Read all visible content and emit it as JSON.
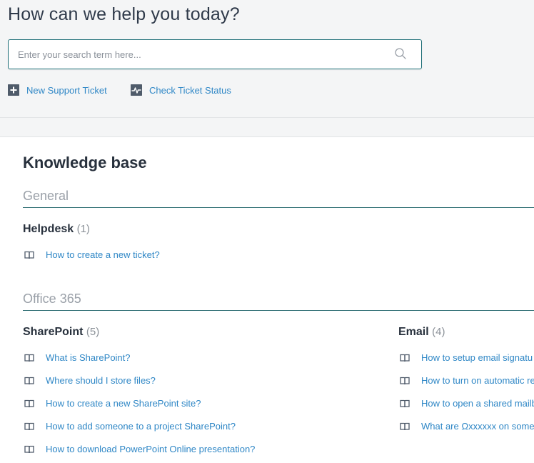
{
  "hero": {
    "title": "How can we help you today?"
  },
  "search": {
    "placeholder": "Enter your search term here...",
    "value": ""
  },
  "actions": {
    "new_ticket": "New Support Ticket",
    "check_status": "Check Ticket Status"
  },
  "knowledge_base": {
    "title": "Knowledge base",
    "categories": [
      {
        "name": "General",
        "sections": [
          {
            "name": "Helpdesk",
            "count": "(1)",
            "articles": [
              "How to create a new ticket?"
            ]
          }
        ]
      },
      {
        "name": "Office 365",
        "sections": [
          {
            "name": "SharePoint",
            "count": "(5)",
            "articles": [
              "What is SharePoint?",
              "Where should I store files?",
              "How to create a new SharePoint site?",
              "How to add someone to a project SharePoint?",
              "How to download PowerPoint Online presentation?"
            ]
          },
          {
            "name": "Email",
            "count": "(4)",
            "articles": [
              "How to setup email signatu",
              "How to turn on automatic re",
              "How to open a shared mailb",
              "What are Ωxxxxxx on some e"
            ]
          }
        ]
      }
    ]
  },
  "colors": {
    "link": "#2f87c6",
    "heading": "#27303c",
    "rule": "#2f6f74",
    "header_bg": "#f4f5f6",
    "search_border": "#1f6f78"
  },
  "icons": {
    "new_ticket": "plus-square-icon",
    "check_status": "activity-pulse-icon",
    "article": "open-book-icon",
    "search": "search-icon"
  }
}
